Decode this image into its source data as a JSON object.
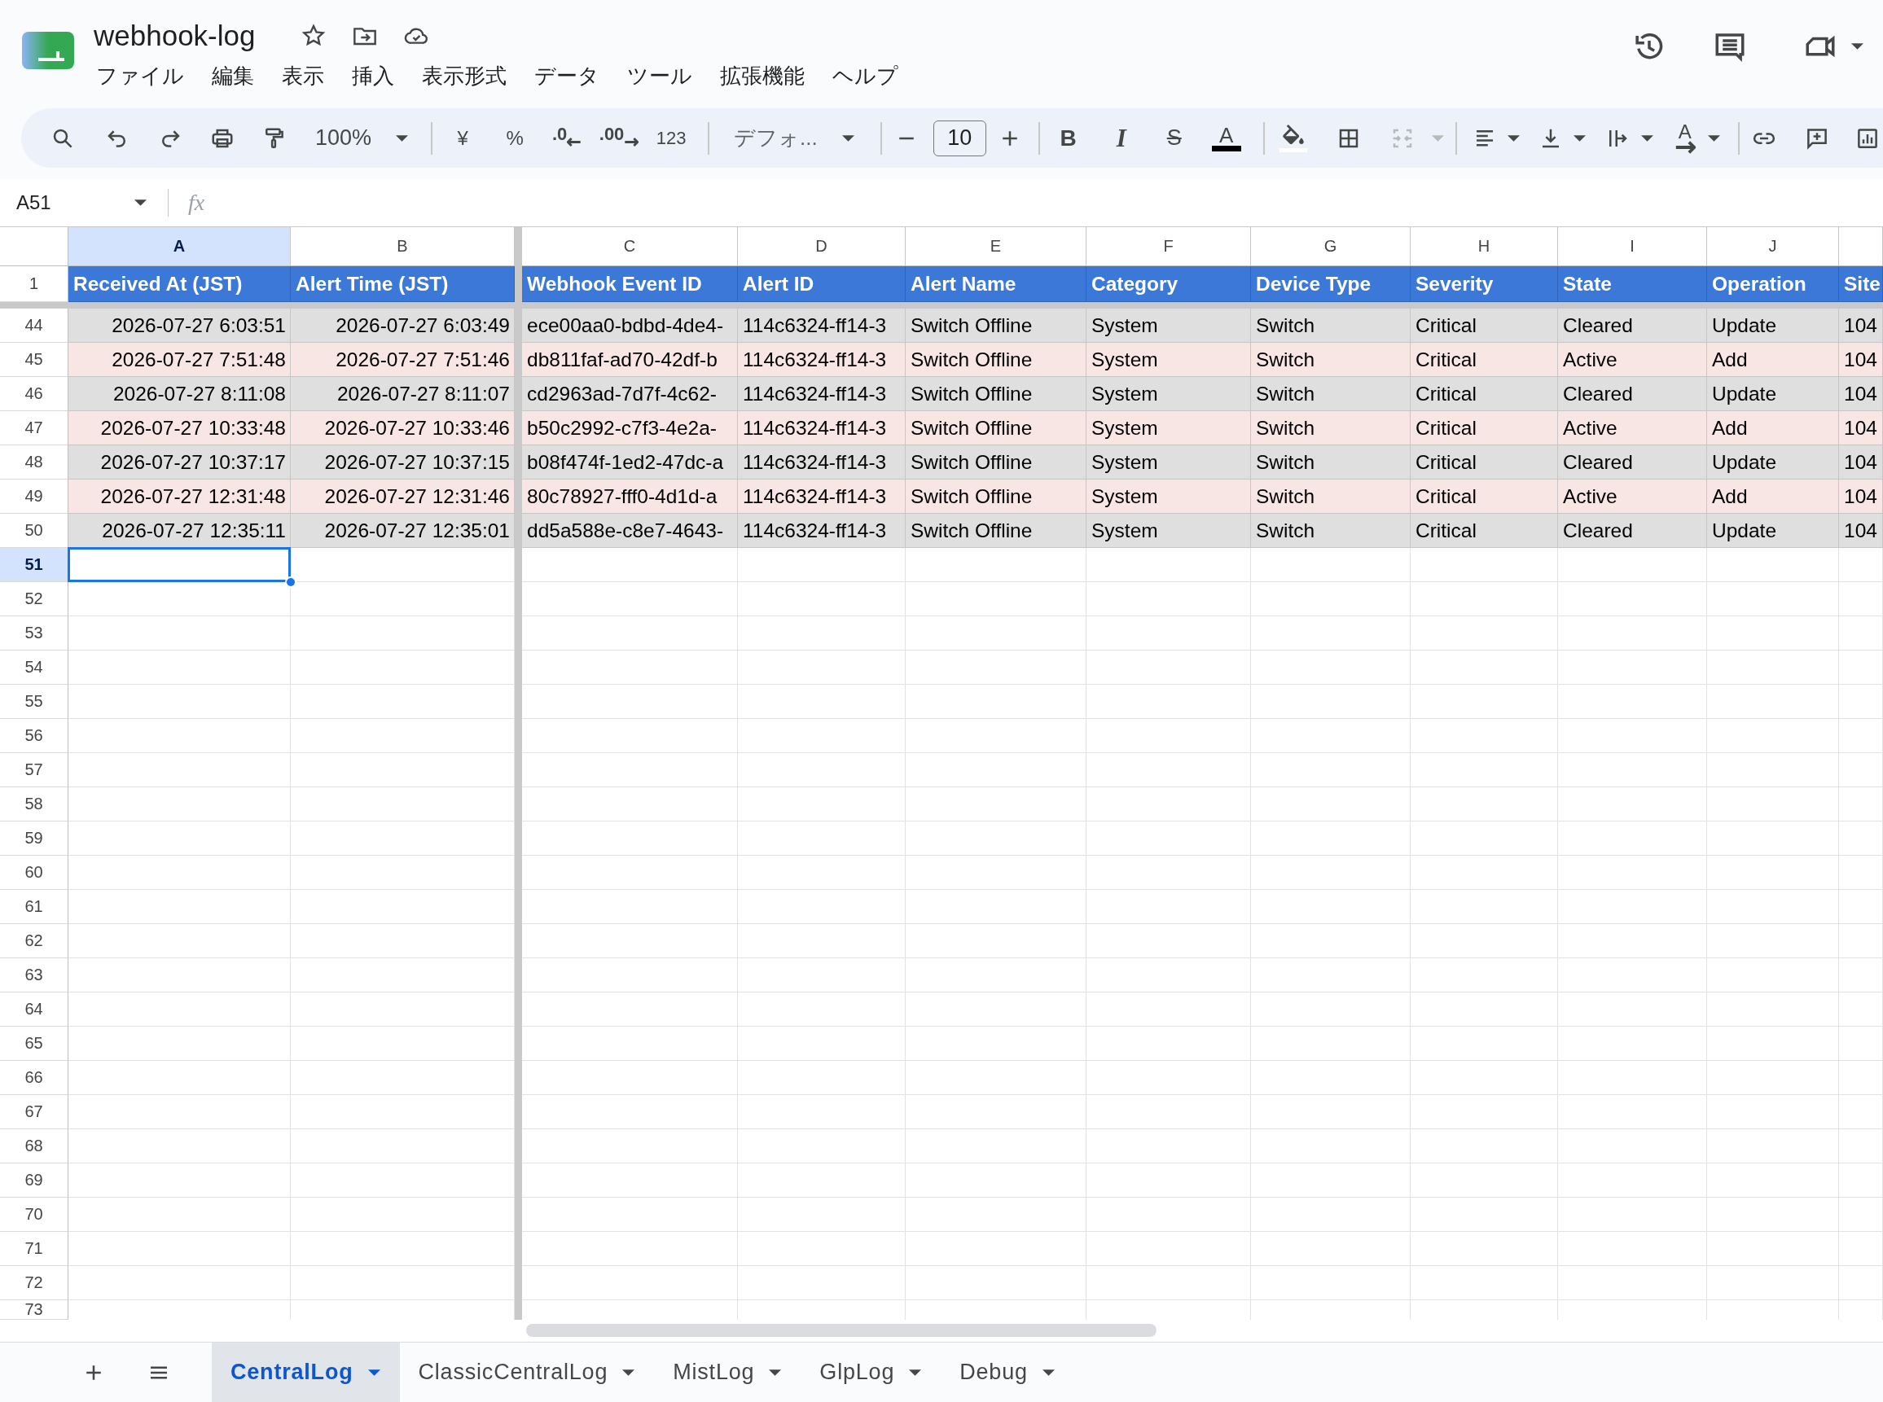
{
  "document": {
    "title": "webhook-log"
  },
  "menu": [
    "ファイル",
    "編集",
    "表示",
    "挿入",
    "表示形式",
    "データ",
    "ツール",
    "拡張機能",
    "ヘルプ"
  ],
  "toolbar": {
    "zoom": "100%",
    "currency": "¥",
    "percent": "%",
    "decrease_decimals": ".0",
    "increase_decimals": ".00",
    "number_format": "123",
    "font": "デフォ...",
    "font_size": "10",
    "bold": "B",
    "italic": "I",
    "strikethrough": "S",
    "text_color": "A",
    "text_rotation": "A",
    "merge_disabled": true
  },
  "formula_bar": {
    "cell_reference": "A51",
    "function_label": "fx"
  },
  "sheet": {
    "columns": [
      {
        "letter": "A",
        "selected": true
      },
      {
        "letter": "B",
        "selected": false
      },
      {
        "letter": "C",
        "selected": false
      },
      {
        "letter": "D",
        "selected": false
      },
      {
        "letter": "E",
        "selected": false
      },
      {
        "letter": "F",
        "selected": false
      },
      {
        "letter": "G",
        "selected": false
      },
      {
        "letter": "H",
        "selected": false
      },
      {
        "letter": "I",
        "selected": false
      },
      {
        "letter": "J",
        "selected": false
      },
      {
        "selected": false
      }
    ],
    "header_row": {
      "number": "1",
      "selected": false,
      "cells": [
        "Received At (JST)",
        "Alert Time (JST)",
        "Webhook Event ID",
        "Alert ID",
        "Alert Name",
        "Category",
        "Device Type",
        "Severity",
        "State",
        "Operation",
        "Site"
      ]
    },
    "rows": [
      {
        "number": "44",
        "selected": false,
        "color": "#dfdfdf",
        "cells": [
          "2026-07-27 6:03:51",
          "2026-07-27 6:03:49",
          "ece00aa0-bdbd-4de4-",
          "114c6324-ff14-3",
          "Switch Offline",
          "System",
          "Switch",
          "Critical",
          "Cleared",
          "Update",
          "104"
        ]
      },
      {
        "number": "45",
        "selected": false,
        "color": "#f8e6e4",
        "cells": [
          "2026-07-27 7:51:48",
          "2026-07-27 7:51:46",
          "db811faf-ad70-42df-b",
          "114c6324-ff14-3",
          "Switch Offline",
          "System",
          "Switch",
          "Critical",
          "Active",
          "Add",
          "104"
        ]
      },
      {
        "number": "46",
        "selected": false,
        "color": "#dfdfdf",
        "cells": [
          "2026-07-27 8:11:08",
          "2026-07-27 8:11:07",
          "cd2963ad-7d7f-4c62-",
          "114c6324-ff14-3",
          "Switch Offline",
          "System",
          "Switch",
          "Critical",
          "Cleared",
          "Update",
          "104"
        ]
      },
      {
        "number": "47",
        "selected": false,
        "color": "#f8e6e4",
        "cells": [
          "2026-07-27 10:33:48",
          "2026-07-27 10:33:46",
          "b50c2992-c7f3-4e2a-",
          "114c6324-ff14-3",
          "Switch Offline",
          "System",
          "Switch",
          "Critical",
          "Active",
          "Add",
          "104"
        ]
      },
      {
        "number": "48",
        "selected": false,
        "color": "#dfdfdf",
        "cells": [
          "2026-07-27 10:37:17",
          "2026-07-27 10:37:15",
          "b08f474f-1ed2-47dc-a",
          "114c6324-ff14-3",
          "Switch Offline",
          "System",
          "Switch",
          "Critical",
          "Cleared",
          "Update",
          "104"
        ]
      },
      {
        "number": "49",
        "selected": false,
        "color": "#f8e6e4",
        "cells": [
          "2026-07-27 12:31:48",
          "2026-07-27 12:31:46",
          "80c78927-fff0-4d1d-a",
          "114c6324-ff14-3",
          "Switch Offline",
          "System",
          "Switch",
          "Critical",
          "Active",
          "Add",
          "104"
        ]
      },
      {
        "number": "50",
        "selected": false,
        "color": "#dfdfdf",
        "cells": [
          "2026-07-27 12:35:11",
          "2026-07-27 12:35:01",
          "dd5a588e-c8e7-4643-",
          "114c6324-ff14-3",
          "Switch Offline",
          "System",
          "Switch",
          "Critical",
          "Cleared",
          "Update",
          "104"
        ]
      },
      {
        "number": "51",
        "selected": true
      },
      {
        "number": "52",
        "selected": false
      },
      {
        "number": "53",
        "selected": false
      },
      {
        "number": "54",
        "selected": false
      },
      {
        "number": "55",
        "selected": false
      },
      {
        "number": "56",
        "selected": false
      },
      {
        "number": "57",
        "selected": false
      },
      {
        "number": "58",
        "selected": false
      },
      {
        "number": "59",
        "selected": false
      },
      {
        "number": "60",
        "selected": false
      },
      {
        "number": "61",
        "selected": false
      },
      {
        "number": "62",
        "selected": false
      },
      {
        "number": "63",
        "selected": false
      },
      {
        "number": "64",
        "selected": false
      },
      {
        "number": "65",
        "selected": false
      },
      {
        "number": "66",
        "selected": false
      },
      {
        "number": "67",
        "selected": false
      },
      {
        "number": "68",
        "selected": false
      },
      {
        "number": "69",
        "selected": false
      },
      {
        "number": "70",
        "selected": false
      },
      {
        "number": "71",
        "selected": false
      },
      {
        "number": "72",
        "selected": false
      },
      {
        "number": "73",
        "selected": false
      }
    ]
  },
  "sheet_tabs": [
    {
      "label": "CentralLog",
      "selected": true
    },
    {
      "label": "ClassicCentralLog",
      "selected": false
    },
    {
      "label": "MistLog",
      "selected": false
    },
    {
      "label": "GlpLog",
      "selected": false
    },
    {
      "label": "Debug",
      "selected": false
    }
  ]
}
